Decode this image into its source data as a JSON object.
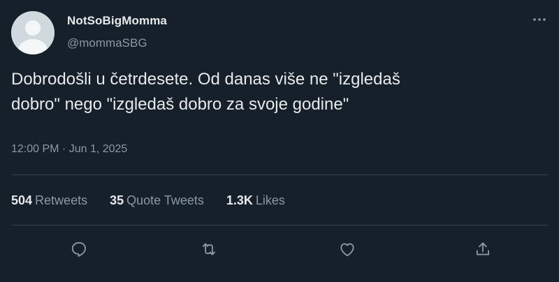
{
  "user": {
    "display_name": "NotSoBigMomma",
    "handle": "@mommaSBG"
  },
  "tweet": {
    "text_line_1": "Dobrodošli u četrdesete. Od danas više ne \"izgledaš",
    "text_line_2": "dobro\" nego \"izgledaš dobro za svoje godine\"",
    "timestamp": "12:00 PM · Jun 1, 2025"
  },
  "stats": {
    "retweets_count": "504",
    "retweets_label": "Retweets",
    "quotes_count": "35",
    "quotes_label": "Quote Tweets",
    "likes_count": "1.3K",
    "likes_label": "Likes"
  },
  "icons": {
    "more": "more-horizontal-icon",
    "reply": "reply-icon",
    "retweet": "retweet-icon",
    "like": "heart-icon",
    "share": "share-icon"
  },
  "colors": {
    "background": "#15202b",
    "primary_text": "#e7e9ea",
    "secondary_text": "#8b98a5",
    "divider": "#38444d"
  }
}
